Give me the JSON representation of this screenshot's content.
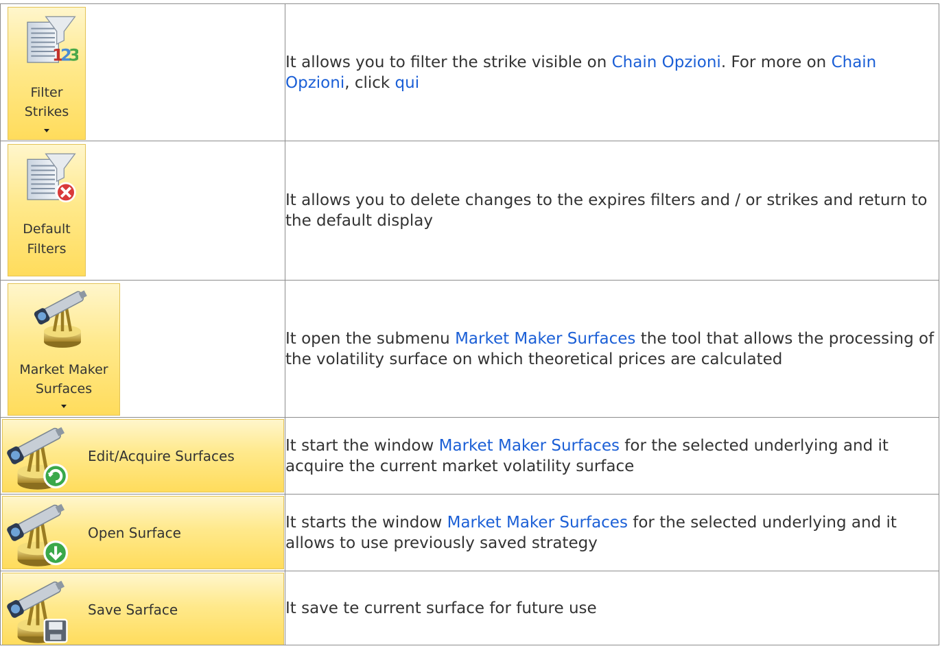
{
  "rows": [
    {
      "button": {
        "label_lines": [
          "Filter",
          "Strikes"
        ],
        "icon": "filter-strikes-icon",
        "has_dropdown": true
      },
      "desc": [
        {
          "text": "It allows you to filter the strike visible on "
        },
        {
          "text": "Chain Opzioni",
          "link": true
        },
        {
          "text": ". For more on "
        },
        {
          "text": "Chain Opzioni",
          "link": true
        },
        {
          "text": ", click "
        },
        {
          "text": "qui",
          "link": true
        }
      ]
    },
    {
      "button": {
        "label_lines": [
          "Default",
          "Filters"
        ],
        "icon": "default-filters-icon",
        "has_dropdown": false
      },
      "desc": [
        {
          "text": "It allows you to delete changes to the expires filters and / or strikes and return to the default display"
        }
      ]
    },
    {
      "button": {
        "label_lines": [
          "Market Maker",
          "Surfaces"
        ],
        "icon": "telescope-icon",
        "has_dropdown": true
      },
      "desc": [
        {
          "text": "It open the submenu "
        },
        {
          "text": "Market Maker Surfaces",
          "link": true
        },
        {
          "text": " the tool that allows the processing of the volatility surface on which theoretical prices are calculated"
        }
      ]
    },
    {
      "button": {
        "label": "Edit/Acquire Surfaces",
        "icon": "telescope-refresh-icon"
      },
      "desc": [
        {
          "text": "It start the window "
        },
        {
          "text": "Market Maker Surfaces",
          "link": true
        },
        {
          "text": " for the selected underlying and it acquire the current market volatility surface"
        }
      ]
    },
    {
      "button": {
        "label": "Open Surface",
        "icon": "telescope-download-icon"
      },
      "desc": [
        {
          "text": "It starts the window "
        },
        {
          "text": "Market Maker Surfaces",
          "link": true
        },
        {
          "text": " for the selected underlying and it allows to use previously saved strategy"
        }
      ]
    },
    {
      "button": {
        "label": "Save Sarface",
        "icon": "telescope-save-icon"
      },
      "desc": [
        {
          "text": "It save te current surface for future use"
        }
      ]
    }
  ],
  "colors": {
    "link": "#1b5fd6",
    "text": "#333333",
    "button_top": "#fff6cc",
    "button_bottom": "#ffdc5c",
    "button_border": "#e2c255",
    "grid": "#8c8c8c"
  }
}
